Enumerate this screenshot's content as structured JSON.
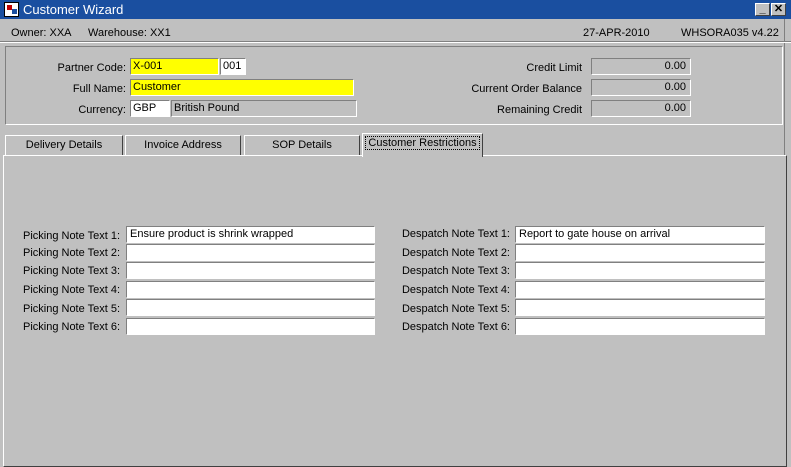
{
  "window": {
    "title": "Customer Wizard",
    "minimize_glyph": "_",
    "close_glyph": "✕"
  },
  "status": {
    "owner": "Owner:  XXA",
    "warehouse": "Warehouse:  XX1",
    "date": "27-APR-2010",
    "program": "WHSORA035  v4.22"
  },
  "header": {
    "partner_code_label": "Partner Code:",
    "partner_code_value": "X-001",
    "partner_code_suffix": "001",
    "full_name_label": "Full Name:",
    "full_name_value": "Customer",
    "currency_label": "Currency:",
    "currency_code": "GBP",
    "currency_name": "British Pound",
    "credit_limit_label": "Credit Limit",
    "credit_limit_value": "0.00",
    "current_order_balance_label": "Current Order Balance",
    "current_order_balance_value": "0.00",
    "remaining_credit_label": "Remaining Credit",
    "remaining_credit_value": "0.00"
  },
  "tabs": [
    {
      "label": "Delivery Details"
    },
    {
      "label": "Invoice Address"
    },
    {
      "label": "SOP Details"
    },
    {
      "label": "Customer Restrictions"
    }
  ],
  "picking": [
    {
      "label": "Picking Note Text 1:",
      "value": "Ensure product is shrink wrapped"
    },
    {
      "label": "Picking Note Text 2:",
      "value": ""
    },
    {
      "label": "Picking Note Text 3:",
      "value": ""
    },
    {
      "label": "Picking Note Text 4:",
      "value": ""
    },
    {
      "label": "Picking Note Text 5:",
      "value": ""
    },
    {
      "label": "Picking Note Text 6:",
      "value": ""
    }
  ],
  "despatch": [
    {
      "label": "Despatch Note Text 1:",
      "value": "Report to gate house on arrival"
    },
    {
      "label": "Despatch Note Text 2:",
      "value": ""
    },
    {
      "label": "Despatch Note Text 3:",
      "value": ""
    },
    {
      "label": "Despatch Note Text 4:",
      "value": ""
    },
    {
      "label": "Despatch Note Text 5:",
      "value": ""
    },
    {
      "label": "Despatch Note Text 6:",
      "value": ""
    }
  ]
}
